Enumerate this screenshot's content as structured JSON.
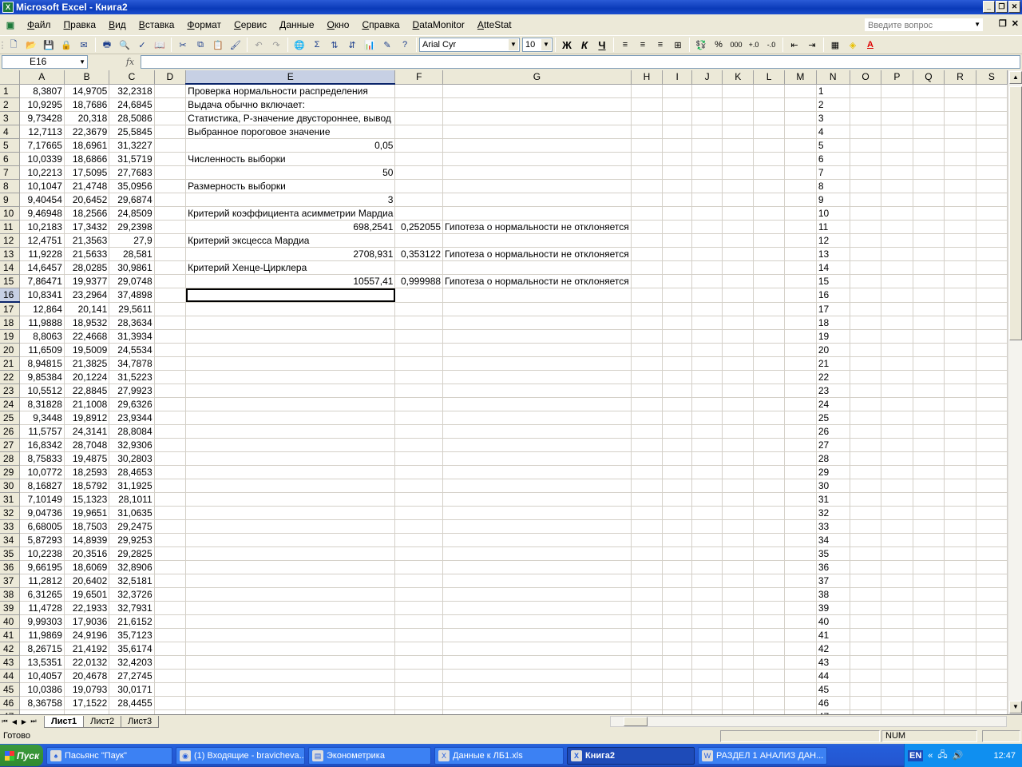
{
  "window": {
    "title": "Microsoft Excel - Книга2",
    "minimize": "_",
    "restore": "❐",
    "close": "✕"
  },
  "menu": {
    "items": [
      "Файл",
      "Правка",
      "Вид",
      "Вставка",
      "Формат",
      "Сервис",
      "Данные",
      "Окно",
      "Справка",
      "DataMonitor",
      "AtteStat"
    ],
    "help_placeholder": "Введите вопрос"
  },
  "toolbar": {
    "font_name": "Arial Cyr",
    "font_size": "10",
    "bold": "Ж",
    "italic": "К",
    "underline": "Ч",
    "percent": "%",
    "thousands": "000",
    "sigma": "Σ"
  },
  "formula_bar": {
    "name_box": "E16",
    "fx": "fx",
    "formula": ""
  },
  "grid": {
    "columns": [
      "A",
      "B",
      "C",
      "D",
      "E",
      "F",
      "G",
      "H",
      "I",
      "J",
      "K",
      "L",
      "M",
      "N",
      "O",
      "P",
      "Q",
      "R",
      "S"
    ],
    "selected_column": "E",
    "selected_row": 16,
    "rows": [
      {
        "n": "1",
        "a": "8,3807",
        "b": "14,9705",
        "c": "32,2318",
        "e": "Проверка нормальности распределения",
        "f": "",
        "g": ""
      },
      {
        "n": "2",
        "a": "10,9295",
        "b": "18,7686",
        "c": "24,6845",
        "e": "Выдача обычно включает:",
        "f": "",
        "g": ""
      },
      {
        "n": "3",
        "a": "9,73428",
        "b": "20,318",
        "c": "28,5086",
        "e": "Статистика, Р-значение двустороннее, вывод",
        "f": "",
        "g": ""
      },
      {
        "n": "4",
        "a": "12,7113",
        "b": "22,3679",
        "c": "25,5845",
        "e": "Выбранное пороговое значение",
        "f": "",
        "g": ""
      },
      {
        "n": "5",
        "a": "7,17665",
        "b": "18,6961",
        "c": "31,3227",
        "e": "0,05",
        "f": "",
        "g": "",
        "enum": true
      },
      {
        "n": "6",
        "a": "10,0339",
        "b": "18,6866",
        "c": "31,5719",
        "e": "Численность выборки",
        "f": "",
        "g": ""
      },
      {
        "n": "7",
        "a": "10,2213",
        "b": "17,5095",
        "c": "27,7683",
        "e": "50",
        "f": "",
        "g": "",
        "enum": true
      },
      {
        "n": "8",
        "a": "10,1047",
        "b": "21,4748",
        "c": "35,0956",
        "e": "Размерность выборки",
        "f": "",
        "g": ""
      },
      {
        "n": "9",
        "a": "9,40454",
        "b": "20,6452",
        "c": "29,6874",
        "e": "3",
        "f": "",
        "g": "",
        "enum": true
      },
      {
        "n": "10",
        "a": "9,46948",
        "b": "18,2566",
        "c": "24,8509",
        "e": "Критерий коэффициента асимметрии Мардиа",
        "f": "",
        "g": ""
      },
      {
        "n": "11",
        "a": "10,2183",
        "b": "17,3432",
        "c": "29,2398",
        "e": "698,2541",
        "f": "0,252055",
        "g": "Гипотеза о нормальности не отклоняется",
        "enum": true
      },
      {
        "n": "12",
        "a": "12,4751",
        "b": "21,3563",
        "c": "27,9",
        "e": "Критерий эксцесса Мардиа",
        "f": "",
        "g": ""
      },
      {
        "n": "13",
        "a": "11,9228",
        "b": "21,5633",
        "c": "28,581",
        "e": "2708,931",
        "f": "0,353122",
        "g": "Гипотеза о нормальности не отклоняется",
        "enum": true
      },
      {
        "n": "14",
        "a": "14,6457",
        "b": "28,0285",
        "c": "30,9861",
        "e": "Критерий Хенце-Цирклера",
        "f": "",
        "g": ""
      },
      {
        "n": "15",
        "a": "7,86471",
        "b": "19,9377",
        "c": "29,0748",
        "e": "10557,41",
        "f": "0,999988",
        "g": "Гипотеза о нормальности не отклоняется",
        "enum": true
      },
      {
        "n": "16",
        "a": "10,8341",
        "b": "23,2964",
        "c": "37,4898",
        "e": "",
        "f": "",
        "g": ""
      },
      {
        "n": "17",
        "a": "12,864",
        "b": "20,141",
        "c": "29,5611",
        "e": "",
        "f": "",
        "g": ""
      },
      {
        "n": "18",
        "a": "11,9888",
        "b": "18,9532",
        "c": "28,3634",
        "e": "",
        "f": "",
        "g": ""
      },
      {
        "n": "19",
        "a": "8,8063",
        "b": "22,4668",
        "c": "31,3934",
        "e": "",
        "f": "",
        "g": ""
      },
      {
        "n": "20",
        "a": "11,6509",
        "b": "19,5009",
        "c": "24,5534",
        "e": "",
        "f": "",
        "g": ""
      },
      {
        "n": "21",
        "a": "8,94815",
        "b": "21,3825",
        "c": "34,7878",
        "e": "",
        "f": "",
        "g": ""
      },
      {
        "n": "22",
        "a": "9,85384",
        "b": "20,1224",
        "c": "31,5223",
        "e": "",
        "f": "",
        "g": ""
      },
      {
        "n": "23",
        "a": "10,5512",
        "b": "22,8845",
        "c": "27,9923",
        "e": "",
        "f": "",
        "g": ""
      },
      {
        "n": "24",
        "a": "8,31828",
        "b": "21,1008",
        "c": "29,6326",
        "e": "",
        "f": "",
        "g": ""
      },
      {
        "n": "25",
        "a": "9,3448",
        "b": "19,8912",
        "c": "23,9344",
        "e": "",
        "f": "",
        "g": ""
      },
      {
        "n": "26",
        "a": "11,5757",
        "b": "24,3141",
        "c": "28,8084",
        "e": "",
        "f": "",
        "g": ""
      },
      {
        "n": "27",
        "a": "16,8342",
        "b": "28,7048",
        "c": "32,9306",
        "e": "",
        "f": "",
        "g": ""
      },
      {
        "n": "28",
        "a": "8,75833",
        "b": "19,4875",
        "c": "30,2803",
        "e": "",
        "f": "",
        "g": ""
      },
      {
        "n": "29",
        "a": "10,0772",
        "b": "18,2593",
        "c": "28,4653",
        "e": "",
        "f": "",
        "g": ""
      },
      {
        "n": "30",
        "a": "8,16827",
        "b": "18,5792",
        "c": "31,1925",
        "e": "",
        "f": "",
        "g": ""
      },
      {
        "n": "31",
        "a": "7,10149",
        "b": "15,1323",
        "c": "28,1011",
        "e": "",
        "f": "",
        "g": ""
      },
      {
        "n": "32",
        "a": "9,04736",
        "b": "19,9651",
        "c": "31,0635",
        "e": "",
        "f": "",
        "g": ""
      },
      {
        "n": "33",
        "a": "6,68005",
        "b": "18,7503",
        "c": "29,2475",
        "e": "",
        "f": "",
        "g": ""
      },
      {
        "n": "34",
        "a": "5,87293",
        "b": "14,8939",
        "c": "29,9253",
        "e": "",
        "f": "",
        "g": ""
      },
      {
        "n": "35",
        "a": "10,2238",
        "b": "20,3516",
        "c": "29,2825",
        "e": "",
        "f": "",
        "g": ""
      },
      {
        "n": "36",
        "a": "9,66195",
        "b": "18,6069",
        "c": "32,8906",
        "e": "",
        "f": "",
        "g": ""
      },
      {
        "n": "37",
        "a": "11,2812",
        "b": "20,6402",
        "c": "32,5181",
        "e": "",
        "f": "",
        "g": ""
      },
      {
        "n": "38",
        "a": "6,31265",
        "b": "19,6501",
        "c": "32,3726",
        "e": "",
        "f": "",
        "g": ""
      },
      {
        "n": "39",
        "a": "11,4728",
        "b": "22,1933",
        "c": "32,7931",
        "e": "",
        "f": "",
        "g": ""
      },
      {
        "n": "40",
        "a": "9,99303",
        "b": "17,9036",
        "c": "21,6152",
        "e": "",
        "f": "",
        "g": ""
      },
      {
        "n": "41",
        "a": "11,9869",
        "b": "24,9196",
        "c": "35,7123",
        "e": "",
        "f": "",
        "g": ""
      },
      {
        "n": "42",
        "a": "8,26715",
        "b": "21,4192",
        "c": "35,6174",
        "e": "",
        "f": "",
        "g": ""
      },
      {
        "n": "43",
        "a": "13,5351",
        "b": "22,0132",
        "c": "32,4203",
        "e": "",
        "f": "",
        "g": ""
      },
      {
        "n": "44",
        "a": "10,4057",
        "b": "20,4678",
        "c": "27,2745",
        "e": "",
        "f": "",
        "g": ""
      },
      {
        "n": "45",
        "a": "10,0386",
        "b": "19,0793",
        "c": "30,0171",
        "e": "",
        "f": "",
        "g": ""
      },
      {
        "n": "46",
        "a": "8,36758",
        "b": "17,1522",
        "c": "28,4455",
        "e": "",
        "f": "",
        "g": ""
      },
      {
        "n": "47",
        "a": "",
        "b": "",
        "c": "",
        "e": "",
        "f": "",
        "g": ""
      }
    ]
  },
  "sheets": {
    "tabs": [
      "Лист1",
      "Лист2",
      "Лист3"
    ],
    "active": "Лист1"
  },
  "status": {
    "text": "Готово",
    "num": "NUM"
  },
  "taskbar": {
    "start": "Пуск",
    "tasks": [
      {
        "label": "Пасьянс \"Паук\"",
        "active": false
      },
      {
        "label": "(1) Входящие - bravicheva...",
        "active": false
      },
      {
        "label": "Эконометрика",
        "active": false
      },
      {
        "label": "Данные к ЛБ1.xls",
        "active": false
      },
      {
        "label": "Книга2",
        "active": true
      },
      {
        "label": "РАЗДЕЛ 1 АНАЛИЗ ДАН...",
        "active": false
      }
    ],
    "lang": "EN",
    "clock": "12:47"
  }
}
